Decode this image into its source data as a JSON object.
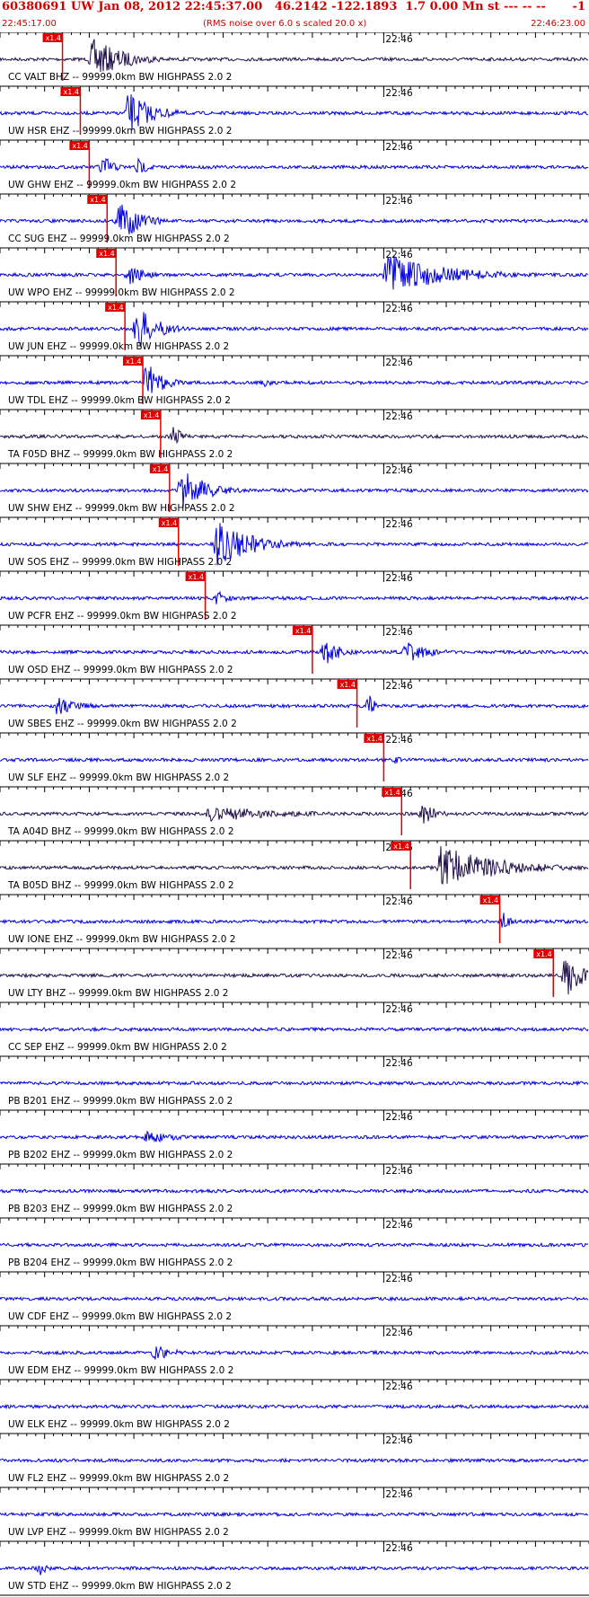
{
  "header": {
    "title": "60380691 UW Jan 08, 2012 22:45:37.00   46.2142 -122.1893  1.7 0.00 Mn st --- -- --",
    "right_text": "-1",
    "start_time": "22:45:17.00",
    "subtitle": "(RMS noise over 6.0 s scaled 20.0 x)",
    "end_time": "22:46:23.00"
  },
  "colors": {
    "header_text": "#d00000",
    "trace_blue": "#0000e0",
    "trace_dark": "#20104a",
    "pick": "#e00000",
    "axis": "#000000"
  },
  "chart_data": {
    "type": "line",
    "title": "60380691 UW Jan 08, 2012 22:45:37.00   46.2142 -122.1893  1.7 0.00 Mn st --- -- --",
    "xlim": [
      "22:45:17.00",
      "22:46:23.00"
    ],
    "minute_marker": "22:46",
    "pick_label": "x1.4",
    "series": [
      {
        "name": "CC VALT BHZ -- 99999.0km BW  HIGHPASS  2.0  2",
        "color": "dark",
        "pick": "22:45:24",
        "bursts": [
          {
            "t": "22:45:27",
            "amp": 0.9,
            "dur": 8
          }
        ]
      },
      {
        "name": "UW HSR EHZ -- 99999.0km BW  HIGHPASS  2.0  2",
        "color": "blue",
        "pick": "22:45:26",
        "bursts": [
          {
            "t": "22:45:31",
            "amp": 0.95,
            "dur": 6
          }
        ]
      },
      {
        "name": "UW GHW EHZ -- 99999.0km BW  HIGHPASS  2.0  2",
        "color": "blue",
        "pick": "22:45:27",
        "bursts": [
          {
            "t": "22:45:28",
            "amp": 0.6,
            "dur": 3
          },
          {
            "t": "22:45:32",
            "amp": 0.4,
            "dur": 3
          }
        ]
      },
      {
        "name": "CC SUG EHZ -- 99999.0km BW  HIGHPASS  2.0  2",
        "color": "blue",
        "pick": "22:45:29",
        "bursts": [
          {
            "t": "22:45:30",
            "amp": 1.0,
            "dur": 5
          }
        ]
      },
      {
        "name": "UW WPO EHZ -- 99999.0km BW  HIGHPASS  2.0  2",
        "color": "blue",
        "pick": "22:45:30",
        "bursts": [
          {
            "t": "22:45:31",
            "amp": 0.5,
            "dur": 4
          },
          {
            "t": "22:46:00",
            "amp": 0.9,
            "dur": 15
          }
        ]
      },
      {
        "name": "UW JUN EHZ -- 99999.0km BW  HIGHPASS  2.0  2",
        "color": "blue",
        "pick": "22:45:31",
        "bursts": [
          {
            "t": "22:45:32",
            "amp": 1.0,
            "dur": 5
          }
        ]
      },
      {
        "name": "UW TDL EHZ -- 99999.0km BW  HIGHPASS  2.0  2",
        "color": "blue",
        "pick": "22:45:33",
        "bursts": [
          {
            "t": "22:45:33",
            "amp": 0.9,
            "dur": 4
          },
          {
            "t": "22:45:46",
            "amp": 0.3,
            "dur": 2
          }
        ]
      },
      {
        "name": "TA F05D BHZ -- 99999.0km BW  HIGHPASS  2.0  2",
        "color": "dark",
        "pick": "22:45:35",
        "bursts": [
          {
            "t": "22:45:36",
            "amp": 0.6,
            "dur": 2
          }
        ]
      },
      {
        "name": "UW SHW EHZ -- 99999.0km BW  HIGHPASS  2.0  2",
        "color": "blue",
        "pick": "22:45:36",
        "bursts": [
          {
            "t": "22:45:37",
            "amp": 1.0,
            "dur": 6
          }
        ]
      },
      {
        "name": "UW SOS EHZ -- 99999.0km BW  HIGHPASS  2.0  2",
        "color": "blue",
        "pick": "22:45:37",
        "bursts": [
          {
            "t": "22:45:41",
            "amp": 1.0,
            "dur": 9
          }
        ]
      },
      {
        "name": "UW PCFR EHZ -- 99999.0km BW  HIGHPASS  2.0  2",
        "color": "blue",
        "pick": "22:45:40",
        "bursts": [
          {
            "t": "22:45:41",
            "amp": 0.35,
            "dur": 3
          }
        ]
      },
      {
        "name": "UW OSD EHZ -- 99999.0km BW  HIGHPASS  2.0  2",
        "color": "blue",
        "pick": "22:45:52",
        "bursts": [
          {
            "t": "22:45:53",
            "amp": 0.6,
            "dur": 4
          },
          {
            "t": "22:46:02",
            "amp": 0.5,
            "dur": 6
          }
        ]
      },
      {
        "name": "UW SBES EHZ -- 99999.0km BW  HIGHPASS  2.0  2",
        "color": "blue",
        "pick": "22:45:57",
        "bursts": [
          {
            "t": "22:45:23",
            "amp": 0.4,
            "dur": 6
          },
          {
            "t": "22:45:58",
            "amp": 0.5,
            "dur": 2
          }
        ]
      },
      {
        "name": "UW SLF EHZ -- 99999.0km BW  HIGHPASS  2.0  2",
        "color": "blue",
        "pick": "22:46:00",
        "bursts": [
          {
            "t": "22:46:01",
            "amp": 0.2,
            "dur": 2
          }
        ]
      },
      {
        "name": "TA A04D BHZ -- 99999.0km BW  HIGHPASS  2.0  2",
        "color": "dark",
        "pick": "22:46:02",
        "bursts": [
          {
            "t": "22:45:40",
            "amp": 0.35,
            "dur": 20
          },
          {
            "t": "22:46:04",
            "amp": 0.6,
            "dur": 3
          }
        ]
      },
      {
        "name": "TA B05D BHZ -- 99999.0km BW  HIGHPASS  2.0  2",
        "color": "dark",
        "pick": "22:46:03",
        "bursts": [
          {
            "t": "22:46:06",
            "amp": 1.0,
            "dur": 14
          }
        ]
      },
      {
        "name": "UW IONE EHZ -- 99999.0km BW  HIGHPASS  2.0  2",
        "color": "blue",
        "pick": "22:46:13",
        "bursts": [
          {
            "t": "22:46:13",
            "amp": 0.4,
            "dur": 2
          }
        ]
      },
      {
        "name": "UW LTY BHZ -- 99999.0km BW  HIGHPASS  2.0  2",
        "color": "dark",
        "pick": "22:46:19",
        "bursts": [
          {
            "t": "22:46:20",
            "amp": 1.0,
            "dur": 4
          }
        ]
      },
      {
        "name": "CC SEP EHZ -- 99999.0km BW  HIGHPASS  2.0  2",
        "color": "blue",
        "pick": null,
        "bursts": []
      },
      {
        "name": "PB B201 EHZ -- 99999.0km BW  HIGHPASS  2.0  2",
        "color": "blue",
        "pick": null,
        "bursts": []
      },
      {
        "name": "PB B202 EHZ -- 99999.0km BW  HIGHPASS  2.0  2",
        "color": "blue",
        "pick": null,
        "bursts": [
          {
            "t": "22:45:33",
            "amp": 0.3,
            "dur": 8
          }
        ]
      },
      {
        "name": "PB B203 EHZ -- 99999.0km BW  HIGHPASS  2.0  2",
        "color": "blue",
        "pick": null,
        "bursts": []
      },
      {
        "name": "PB B204 EHZ -- 99999.0km BW  HIGHPASS  2.0  2",
        "color": "blue",
        "pick": null,
        "bursts": []
      },
      {
        "name": "UW CDF EHZ -- 99999.0km BW  HIGHPASS  2.0  2",
        "color": "blue",
        "pick": null,
        "bursts": []
      },
      {
        "name": "UW EDM EHZ -- 99999.0km BW  HIGHPASS  2.0  2",
        "color": "blue",
        "pick": null,
        "bursts": [
          {
            "t": "22:45:34",
            "amp": 0.35,
            "dur": 5
          }
        ]
      },
      {
        "name": "UW ELK EHZ -- 99999.0km BW  HIGHPASS  2.0  2",
        "color": "blue",
        "pick": null,
        "bursts": []
      },
      {
        "name": "UW FL2 EHZ -- 99999.0km BW  HIGHPASS  2.0  2",
        "color": "blue",
        "pick": null,
        "bursts": []
      },
      {
        "name": "UW LVP EHZ -- 99999.0km BW  HIGHPASS  2.0  2",
        "color": "blue",
        "pick": null,
        "bursts": []
      },
      {
        "name": "UW STD EHZ -- 99999.0km BW  HIGHPASS  2.0  2",
        "color": "blue",
        "pick": null,
        "bursts": [
          {
            "t": "22:45:21",
            "amp": 0.35,
            "dur": 2
          }
        ]
      }
    ]
  }
}
